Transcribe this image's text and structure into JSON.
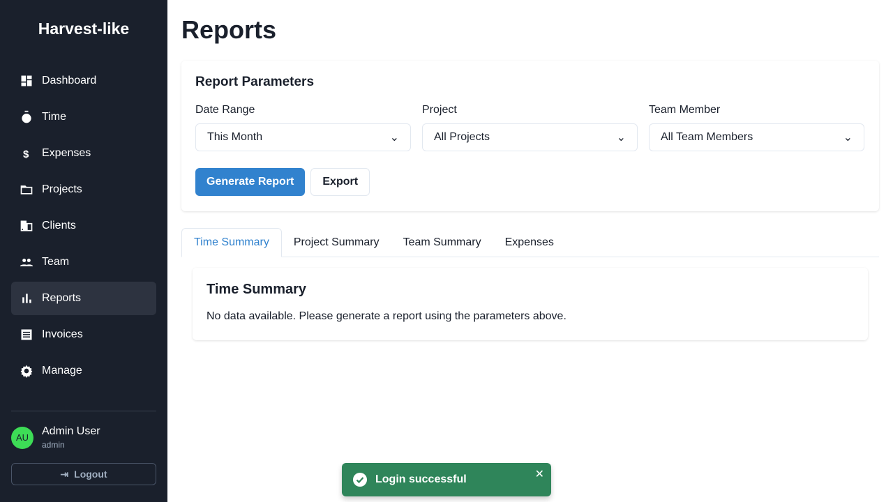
{
  "sidebar": {
    "brand": "Harvest-like",
    "items": [
      {
        "label": "Dashboard",
        "icon": "dashboard-icon"
      },
      {
        "label": "Time",
        "icon": "stopwatch-icon"
      },
      {
        "label": "Expenses",
        "icon": "dollar-icon"
      },
      {
        "label": "Projects",
        "icon": "folder-icon"
      },
      {
        "label": "Clients",
        "icon": "building-icon"
      },
      {
        "label": "Team",
        "icon": "people-icon"
      },
      {
        "label": "Reports",
        "icon": "bar-chart-icon",
        "active": true
      },
      {
        "label": "Invoices",
        "icon": "invoice-icon"
      },
      {
        "label": "Manage",
        "icon": "gear-icon"
      }
    ],
    "user": {
      "initials": "AU",
      "name": "Admin User",
      "role": "admin"
    },
    "logout": "Logout"
  },
  "page": {
    "title": "Reports"
  },
  "params": {
    "title": "Report Parameters",
    "date_range": {
      "label": "Date Range",
      "value": "This Month"
    },
    "project": {
      "label": "Project",
      "value": "All Projects"
    },
    "team_member": {
      "label": "Team Member",
      "value": "All Team Members"
    },
    "generate": "Generate Report",
    "export": "Export"
  },
  "tabs": [
    "Time Summary",
    "Project Summary",
    "Team Summary",
    "Expenses"
  ],
  "panel": {
    "title": "Time Summary",
    "message": "No data available. Please generate a report using the parameters above."
  },
  "toast": {
    "message": "Login successful",
    "close": "✕"
  },
  "colors": {
    "sidebar": "#1a202c",
    "accent": "#3182ce",
    "toast": "#2f855a",
    "avatar": "#3ddc56"
  }
}
